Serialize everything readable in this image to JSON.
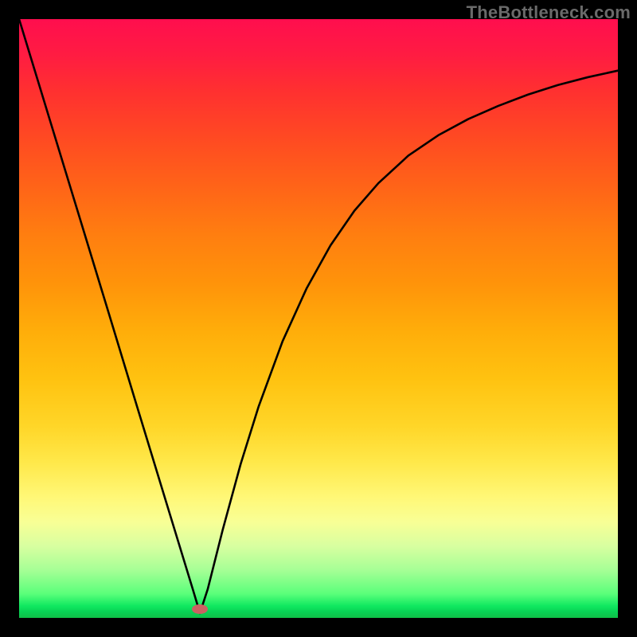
{
  "watermark": "TheBottleneck.com",
  "marker": {
    "x_frac": 0.302,
    "y_frac": 0.985
  },
  "chart_data": {
    "type": "line",
    "title": "",
    "xlabel": "",
    "ylabel": "",
    "xlim": [
      0,
      1
    ],
    "ylim": [
      0,
      1
    ],
    "series": [
      {
        "name": "bottleneck-curve",
        "x": [
          0.0,
          0.05,
          0.1,
          0.15,
          0.2,
          0.25,
          0.29,
          0.302,
          0.315,
          0.34,
          0.37,
          0.4,
          0.44,
          0.48,
          0.52,
          0.56,
          0.6,
          0.65,
          0.7,
          0.75,
          0.8,
          0.85,
          0.9,
          0.95,
          1.0
        ],
        "y": [
          1.0,
          0.836,
          0.672,
          0.508,
          0.343,
          0.179,
          0.048,
          0.008,
          0.048,
          0.147,
          0.257,
          0.353,
          0.462,
          0.55,
          0.622,
          0.68,
          0.726,
          0.772,
          0.806,
          0.833,
          0.855,
          0.874,
          0.89,
          0.903,
          0.914
        ]
      }
    ],
    "gradient_stops": [
      {
        "pos": 0.0,
        "color": "#ff0e4e"
      },
      {
        "pos": 0.5,
        "color": "#ffad0a"
      },
      {
        "pos": 0.8,
        "color": "#fff878"
      },
      {
        "pos": 1.0,
        "color": "#10c048"
      }
    ]
  }
}
